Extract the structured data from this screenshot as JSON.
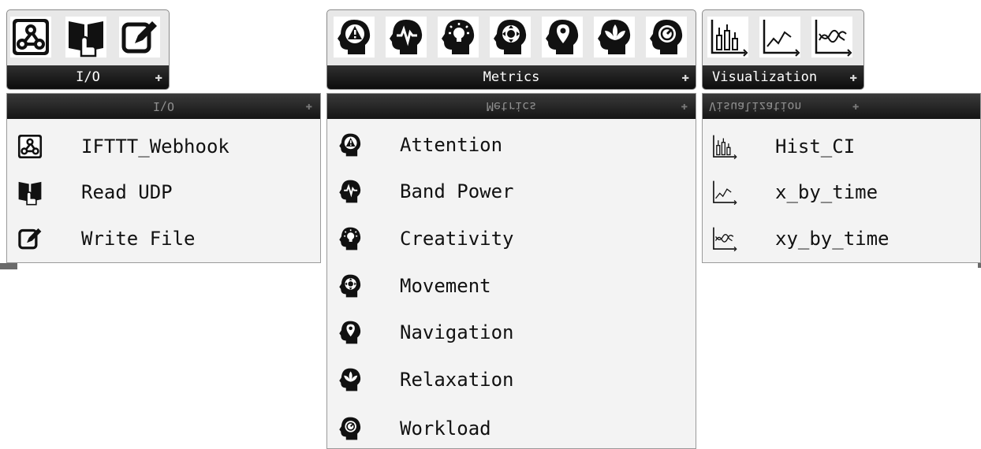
{
  "io": {
    "toolbar_label": "I/O",
    "icons": [
      "webhook-icon",
      "read-udp-icon",
      "write-file-icon"
    ],
    "menu_header": "I\\O",
    "items": [
      {
        "label": "IFTTT_Webhook",
        "icon": "webhook-icon"
      },
      {
        "label": "Read UDP",
        "icon": "read-udp-icon"
      },
      {
        "label": "Write File",
        "icon": "write-file-icon"
      }
    ]
  },
  "metrics": {
    "toolbar_label": "Metrics",
    "icons": [
      "attention-icon",
      "band-power-icon",
      "creativity-icon",
      "movement-icon",
      "navigation-icon",
      "relaxation-icon",
      "workload-icon"
    ],
    "menu_header": "Metrics",
    "items": [
      {
        "label": "Attention",
        "icon": "attention-icon"
      },
      {
        "label": "Band Power",
        "icon": "band-power-icon"
      },
      {
        "label": "Creativity",
        "icon": "creativity-icon"
      },
      {
        "label": "Movement",
        "icon": "movement-icon"
      },
      {
        "label": "Navigation",
        "icon": "navigation-icon"
      },
      {
        "label": "Relaxation",
        "icon": "relaxation-icon"
      },
      {
        "label": "Workload",
        "icon": "workload-icon"
      }
    ]
  },
  "visualization": {
    "toolbar_label": "Visualization",
    "icons": [
      "hist-ci-icon",
      "x-by-time-icon",
      "xy-by-time-icon"
    ],
    "menu_header": "Visualization",
    "items": [
      {
        "label": "Hist_CI",
        "icon": "hist-ci-icon"
      },
      {
        "label": "x_by_time",
        "icon": "x-by-time-icon"
      },
      {
        "label": "xy_by_time",
        "icon": "xy-by-time-icon"
      }
    ]
  },
  "arrow_glyph": "✚"
}
